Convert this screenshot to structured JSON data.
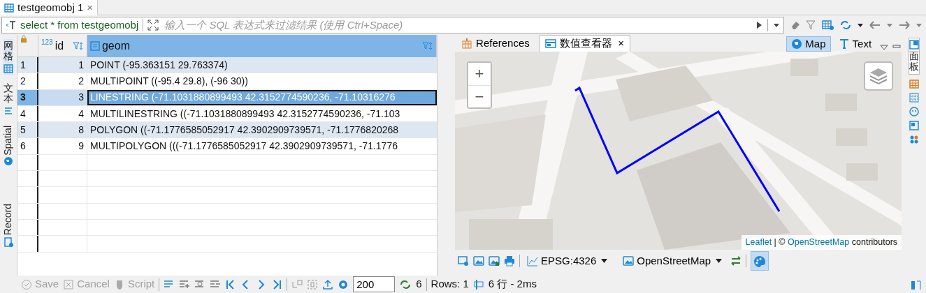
{
  "editor_tab": {
    "title": "testgeomobj 1",
    "selected": true,
    "close": "×"
  },
  "filter": {
    "query": "select * from testgeomobj",
    "placeholder": "输入一个 SQL 表达式来过滤结果 (使用 Ctrl+Space)"
  },
  "left_tabs": [
    {
      "label": "网格",
      "kind": "cjk",
      "selected": true
    },
    {
      "label": "文本",
      "kind": "cjk",
      "selected": false
    },
    {
      "label": "Spatial",
      "kind": "latin",
      "selected": false
    },
    {
      "label": "Record",
      "kind": "latin",
      "selected": false
    }
  ],
  "table": {
    "columns": [
      {
        "label": "id",
        "type_badge": "123",
        "selected": false
      },
      {
        "label": "geom",
        "selected": true
      }
    ],
    "rows": [
      {
        "row_number": "1",
        "id": "1",
        "geom": "POINT (-95.363151 29.763374)",
        "selected": false
      },
      {
        "row_number": "2",
        "id": "2",
        "geom": "MULTIPOINT ((-95.4 29.8), (-96 30))",
        "selected": false
      },
      {
        "row_number": "3",
        "id": "3",
        "geom": "LINESTRING (-71.1031880899493 42.3152774590236, -71.10316276",
        "selected": true
      },
      {
        "row_number": "4",
        "id": "4",
        "geom": "MULTILINESTRING ((-71.1031880899493 42.3152774590236, -71.103",
        "selected": false
      },
      {
        "row_number": "5",
        "id": "8",
        "geom": "POLYGON ((-71.1776585052917 42.3902909739571, -71.1776820268",
        "selected": false
      },
      {
        "row_number": "6",
        "id": "9",
        "geom": "MULTIPOLYGON (((-71.1776585052917 42.3902909739571, -71.1776",
        "selected": false
      }
    ]
  },
  "viewer_tabs": [
    {
      "label": "References",
      "selected": false
    },
    {
      "label": "数值查看器",
      "selected": true,
      "close": "×"
    }
  ],
  "view_modes": [
    {
      "label": "Map",
      "selected": true
    },
    {
      "label": "Text",
      "selected": false
    }
  ],
  "map": {
    "zoom_in": "+",
    "zoom_out": "−",
    "attribution": {
      "leaflet": "Leaflet",
      "separator": "| ©",
      "osm": "OpenStreetMap",
      "suffix": "contributors"
    }
  },
  "map_toolbar": {
    "crs": "EPSG:4326",
    "tiles": "OpenStreetMap",
    "palette_on": true
  },
  "right_tabs": [
    {
      "label": "面板"
    }
  ],
  "bottom_toolbar": {
    "buttons": [
      {
        "label": "Save",
        "disabled": true
      },
      {
        "label": "Cancel",
        "disabled": true
      },
      {
        "label": "Script",
        "disabled": true
      }
    ],
    "fetch_size": "200",
    "refresh_count": "6",
    "rows": "Rows: 1",
    "timing": "6 行 - 2ms"
  }
}
